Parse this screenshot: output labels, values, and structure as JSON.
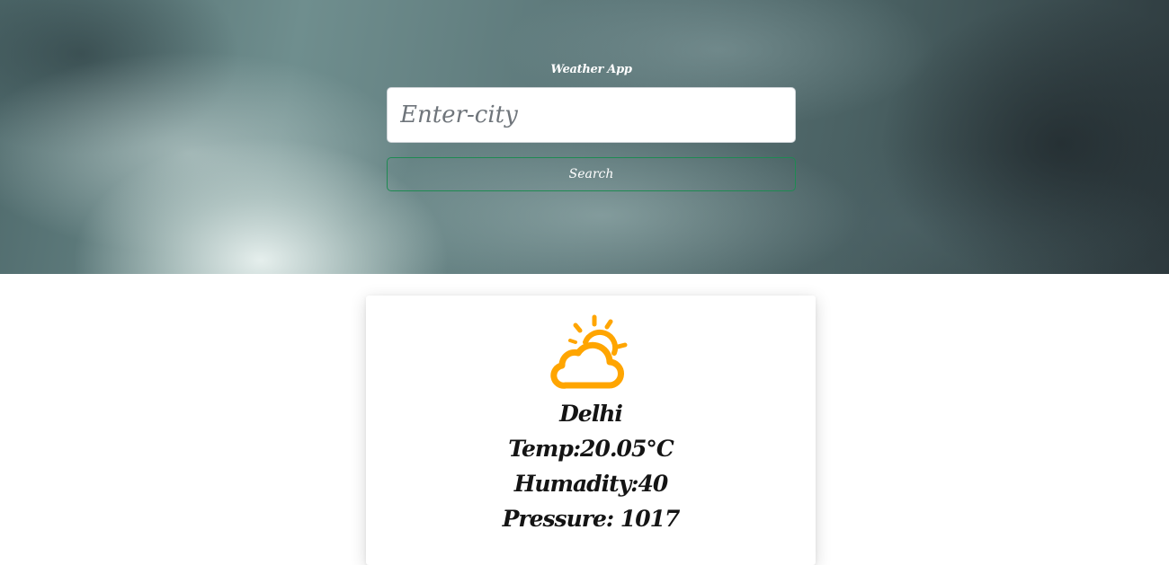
{
  "header": {
    "title": "Weather App"
  },
  "search": {
    "placeholder": "Enter-city",
    "value": "",
    "button_label": "Search"
  },
  "weather": {
    "icon": "partly-cloudy-icon",
    "icon_color": "#FFA500",
    "city": "Delhi",
    "temperature": "Temp:20.05°C",
    "humidity": "Humadity:40",
    "pressure": "Pressure: 1017"
  }
}
